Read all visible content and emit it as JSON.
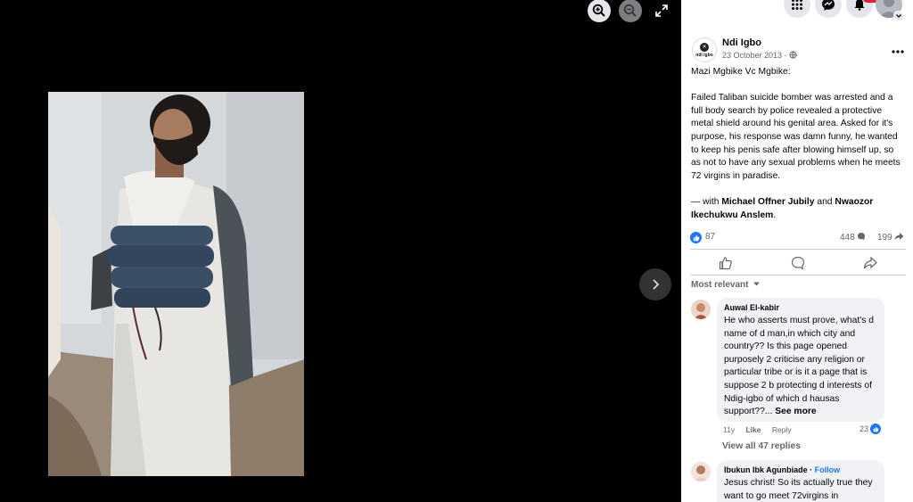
{
  "viewer": {
    "icons": {
      "zoom_in": "zoom-in-icon",
      "zoom_out": "zoom-out-icon",
      "fullscreen": "fullscreen-icon",
      "next": "chevron-right-icon"
    }
  },
  "topbar": {
    "icons": [
      "menu-grid-icon",
      "messenger-icon",
      "bell-icon",
      "profile-avatar"
    ]
  },
  "post": {
    "page_name": "Ndi Igbo",
    "avatar_text": "ndi igbo",
    "date": "23 October 2013 · ",
    "title_line": "Mazi Mgbike Vc Mgbike:",
    "body": "Failed Taliban suicide bomber was arrested and a full body search by police revealed a protective metal shield around his genital area. Asked for it's purpose, his response was damn funny, he wanted to keep his penis safe after blowing himself up, so as not to have any sexual problems when he meets 72 virgins in paradise.",
    "with_prefix": "— with ",
    "tag1": "Michael Offner Jubily",
    "and": " and ",
    "tag2": "Nwaozor Ikechukwu Anslem",
    "period": "."
  },
  "stats": {
    "likes": "87",
    "comments": "448",
    "shares": "199"
  },
  "comments": {
    "sort_label": "Most relevant",
    "items": [
      {
        "name": "Auwal El-kabir",
        "text": "He who asserts must prove, what's d name of d man,in which city and country?? Is this page opened purposely 2 criticise any religion or particular tribe or is it a page that is suppose 2 b protecting d interests of Ndig-igbo of which d hausas support??...",
        "see_more": " See more",
        "time": "11y",
        "like": "Like",
        "reply": "Reply",
        "reactions": "23"
      },
      {
        "name": "Ibukun Ibk Agunbiade",
        "dot": " · ",
        "follow": "Follow",
        "text": "Jesus christ! So its actually true they want to go meet 72virgins in"
      }
    ],
    "view_replies": "View all 47 replies"
  },
  "colors": {
    "accent": "#1877f2",
    "panel_bg": "#ffffff",
    "viewer_bg": "#000000",
    "badge": "#e41e3f"
  }
}
